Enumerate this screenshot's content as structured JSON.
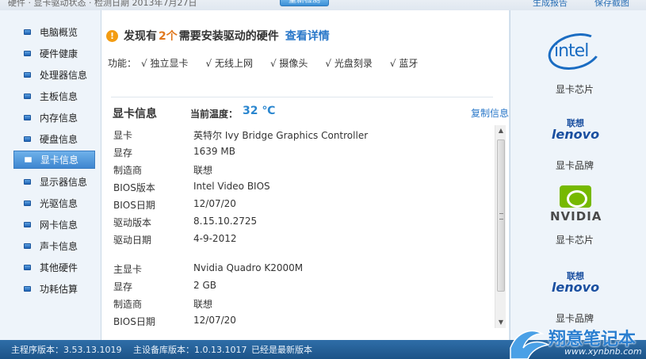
{
  "topbar": {
    "text": "硬件 · 显卡驱动状态 · 检测日期 2013年7月27日",
    "button": "重新检测",
    "link1": "生成报告",
    "link2": "保存截图"
  },
  "sidebar": {
    "items": [
      {
        "label": "电脑概览",
        "active": false
      },
      {
        "label": "硬件健康",
        "active": false
      },
      {
        "label": "处理器信息",
        "active": false
      },
      {
        "label": "主板信息",
        "active": false
      },
      {
        "label": "内存信息",
        "active": false
      },
      {
        "label": "硬盘信息",
        "active": false
      },
      {
        "label": "显卡信息",
        "active": true
      },
      {
        "label": "显示器信息",
        "active": false
      },
      {
        "label": "光驱信息",
        "active": false
      },
      {
        "label": "网卡信息",
        "active": false
      },
      {
        "label": "声卡信息",
        "active": false
      },
      {
        "label": "其他硬件",
        "active": false
      },
      {
        "label": "功耗估算",
        "active": false
      }
    ]
  },
  "alert": {
    "prefix": "发现有",
    "count": "2个",
    "suffix": "需要安装驱动的硬件",
    "link": "查看详情"
  },
  "features": {
    "label": "功能：",
    "items": [
      "√ 独立显卡",
      "√ 无线上网",
      "√ 摄像头",
      "√ 光盘刻录",
      "√ 蓝牙"
    ]
  },
  "gpu_card": {
    "title": "显卡信息",
    "temp_label": "当前温度：",
    "temp_value": "32 ℃",
    "copy_link": "复制信息"
  },
  "gpu1": [
    {
      "key": "显卡",
      "value": "英特尔 Ivy Bridge Graphics Controller"
    },
    {
      "key": "显存",
      "value": "1639 MB"
    },
    {
      "key": "制造商",
      "value": "联想"
    },
    {
      "key": "BIOS版本",
      "value": "Intel Video BIOS"
    },
    {
      "key": "BIOS日期",
      "value": "12/07/20"
    },
    {
      "key": "驱动版本",
      "value": "8.15.10.2725"
    },
    {
      "key": "驱动日期",
      "value": "4-9-2012"
    }
  ],
  "gpu2": [
    {
      "key": "主显卡",
      "value": "Nvidia Quadro K2000M"
    },
    {
      "key": "显存",
      "value": "2 GB"
    },
    {
      "key": "制造商",
      "value": "联想"
    },
    {
      "key": "BIOS日期",
      "value": "12/07/20"
    }
  ],
  "brands": [
    {
      "logo": "intel-logo",
      "text": "intel",
      "label": "显卡芯片"
    },
    {
      "logo": "lenovo-logo",
      "cn": "联想",
      "en": "lenovo",
      "label": "显卡品牌"
    },
    {
      "logo": "nvidia-logo",
      "text": "NVIDIA",
      "label": "显卡芯片"
    },
    {
      "logo": "lenovo-logo",
      "cn": "联想",
      "en": "lenovo",
      "label": "显卡品牌"
    }
  ],
  "status": {
    "program_version": "主程序版本：3.53.13.1019",
    "db_version": "主设备库版本：1.0.13.1017",
    "update_state": "已经是最新版本"
  },
  "watermark": {
    "name": "翔意笔记本",
    "url": "www.xynbnb.com"
  },
  "colors": {
    "accent": "#2a78c9",
    "active_nav": "#3e86d0",
    "warning": "#e0781e",
    "status_bar": "#1c5388"
  }
}
